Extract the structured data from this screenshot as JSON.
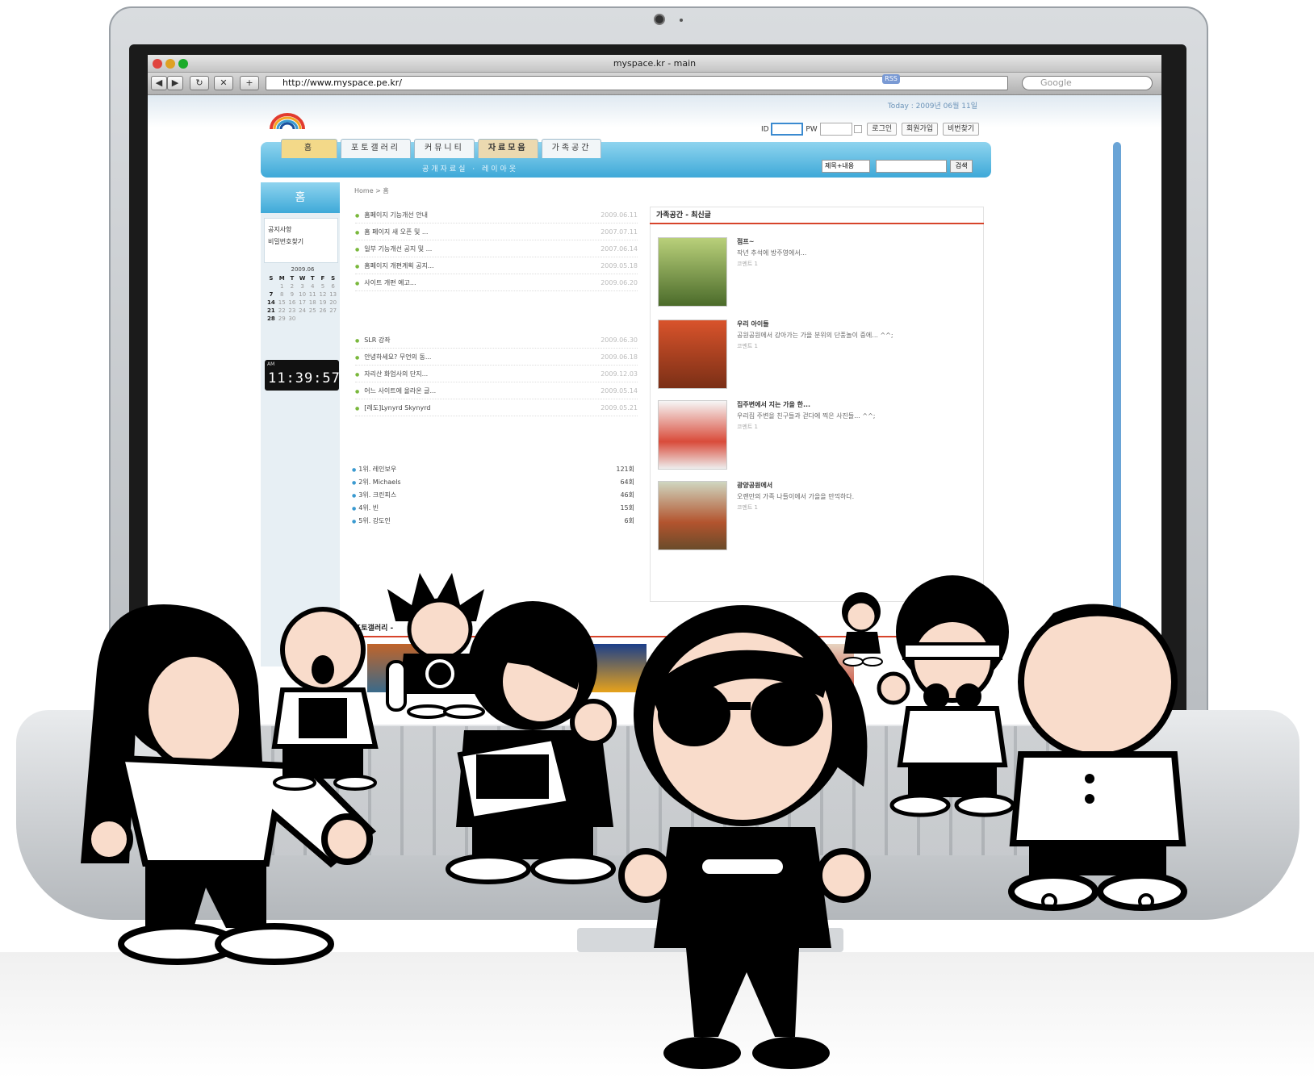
{
  "window": {
    "title": "myspace.kr - main",
    "url": "http://www.myspace.pe.kr/",
    "rss": "RSS",
    "search_placeholder": "Google"
  },
  "header": {
    "today": "Today : 2009년 06월 11일",
    "id_label": "ID",
    "pw_label": "PW",
    "login": "로그인",
    "join": "회원가입",
    "findpw": "비번찾기"
  },
  "nav": {
    "tabs": [
      "홈",
      "포토갤러리",
      "커뮤니티",
      "자료모음",
      "가족공간"
    ],
    "sub": "공개자료실 · 레이아웃",
    "search_select": "제목+내용",
    "search_btn": "검색"
  },
  "sidebar": {
    "title": "홈",
    "items": [
      "공지사항",
      "비밀번호찾기"
    ],
    "cal_title": "2009.06",
    "clock_ampm": "AM",
    "clock": "11:39:57"
  },
  "breadcrumb": "Home > 홈",
  "notices": [
    {
      "t": "홈페이지 기능개선 안내",
      "d": "2009.06.11"
    },
    {
      "t": "홈 페이지 새 오픈 및 ...",
      "d": "2007.07.11"
    },
    {
      "t": "일부 기능개선 공지 및 ...",
      "d": "2007.06.14"
    },
    {
      "t": "홈페이지 개편계획 공지...",
      "d": "2009.05.18"
    },
    {
      "t": "사이트 개편 예고...",
      "d": "2009.06.20"
    }
  ],
  "posts": [
    {
      "t": "SLR 강좌",
      "d": "2009.06.30"
    },
    {
      "t": "안녕하세요? 무언의 동...",
      "d": "2009.06.18"
    },
    {
      "t": "자리산 화엄사의 단지...",
      "d": "2009.12.03"
    },
    {
      "t": "어느 사이트에 올라온 글...",
      "d": "2009.05.14"
    },
    {
      "t": "[레도]Lynyrd Skynyrd",
      "d": "2009.05.21"
    }
  ],
  "ranking": [
    {
      "t": "1위. 레인보우",
      "v": "121회"
    },
    {
      "t": "2위. Michaels",
      "v": "64회"
    },
    {
      "t": "3위. 크린피스",
      "v": "46회"
    },
    {
      "t": "4위. 빈",
      "v": "15회"
    },
    {
      "t": "5위. 강도인",
      "v": "6회"
    }
  ],
  "family": {
    "title": "가족공간 - 최신글",
    "items": [
      {
        "title": "점프~",
        "desc": "작년 추석에 방주영에서...",
        "cmt": "코멘트 1"
      },
      {
        "title": "우리 아이들",
        "desc": "공원공원에서 강아가는 가을 분위의 단풍놀이 중에... ^^;",
        "cmt": "코멘트 1"
      },
      {
        "title": "집주변에서 지는 가을 한...",
        "desc": "우리집 주변을 친구들과 걷다에 찍은 사진들... ^^;",
        "cmt": "코멘트 1"
      },
      {
        "title": "광양공원에서",
        "desc": "오랜만의 가족 나들이에서 가을을 만끽하다.",
        "cmt": "코멘트 1"
      }
    ]
  },
  "photo_title": "포토갤러리 - ",
  "colors": {
    "accent": "#3ea9d8",
    "tab_active": "#f3d989",
    "headline_red": "#d7442b"
  }
}
